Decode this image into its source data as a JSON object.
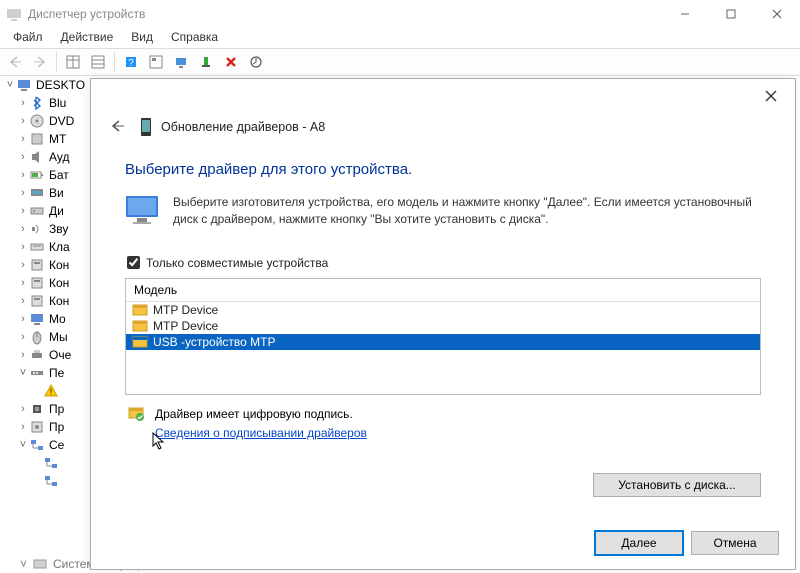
{
  "window": {
    "title": "Диспетчер устройств",
    "min": "—",
    "max": "▢",
    "close": "✕"
  },
  "menu": {
    "file": "Файл",
    "action": "Действие",
    "view": "Вид",
    "help": "Справка"
  },
  "tree": {
    "root": "DESKTO",
    "items": [
      "Blu",
      "DVD",
      "MT",
      "Ауд",
      "Бат",
      "Ви",
      "Ди",
      "Зву",
      "Кла",
      "Кон",
      "Кон",
      "Кон",
      "Mo",
      "Мы",
      "Оче",
      "Пе",
      "",
      "Пр",
      "Пр",
      "Се",
      "",
      "",
      "Системные устройства"
    ]
  },
  "dialog": {
    "title": "Обновление драйверов - A8",
    "heading": "Выберите драйвер для этого устройства.",
    "instruction": "Выберите изготовителя устройства, его модель и нажмите кнопку \"Далее\". Если имеется установочный диск с драйвером, нажмите кнопку \"Вы хотите установить с диска\".",
    "compatible_label": "Только совместимые устройства",
    "compatible_checked": true,
    "model_header": "Модель",
    "models": [
      "MTP Device",
      "MTP Device",
      "USB -устройство MTP"
    ],
    "selected_index": 2,
    "signature_text": "Драйвер имеет цифровую подпись.",
    "signature_link": "Сведения о подписывании драйверов",
    "install_from_disk": "Установить с диска...",
    "next": "Далее",
    "cancel": "Отмена"
  }
}
